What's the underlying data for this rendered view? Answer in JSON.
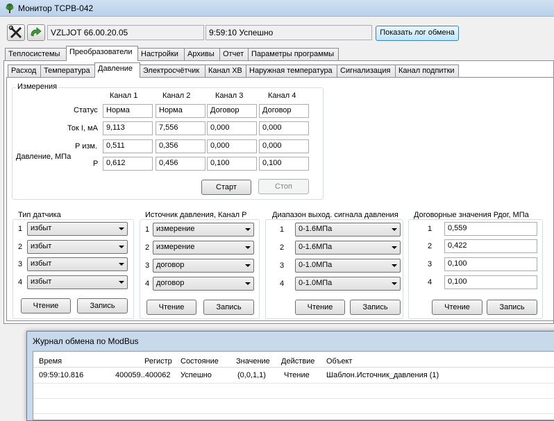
{
  "window": {
    "title": "Монитор ТСРВ-042",
    "app_icon": "tree-icon"
  },
  "toolbar": {
    "device": "VZLJOT 66.00.20.05",
    "status": "9:59:10 Успешно",
    "show_log_label": "Показать лог обмена",
    "tools_icon": "tools-icon",
    "refresh_icon": "refresh-arrow-icon"
  },
  "main_tabs": [
    "Теплосистемы",
    "Преобразователи",
    "Настройки",
    "Архивы",
    "Отчет",
    "Параметры программы"
  ],
  "sub_tabs": [
    "Расход",
    "Температура",
    "Давление",
    "Электросчётчик",
    "Канал ХВ",
    "Наружная температура",
    "Сигнализация",
    "Канал подпитки"
  ],
  "measure": {
    "title": "Измерения",
    "channels": [
      "Канал 1",
      "Канал 2",
      "Канал 3",
      "Канал 4"
    ],
    "status_label": "Статус",
    "current_label": "Ток I, мА",
    "pressure_label": "Давление, МПа",
    "p_meas_label": "P изм.",
    "p_label": "P",
    "status": [
      "Норма",
      "Норма",
      "Договор",
      "Договор"
    ],
    "current": [
      "9,113",
      "7,556",
      "0,000",
      "0,000"
    ],
    "p_meas": [
      "0,511",
      "0,356",
      "0,000",
      "0,000"
    ],
    "p": [
      "0,612",
      "0,456",
      "0,100",
      "0,100"
    ],
    "start_label": "Старт",
    "stop_label": "Стоп"
  },
  "sensor_type": {
    "title": "Тип датчика",
    "items": [
      "избыт",
      "избыт",
      "избыт",
      "избыт"
    ]
  },
  "pressure_source": {
    "title": "Источник давления, Канал P",
    "items": [
      "измерение",
      "измерение",
      "договор",
      "договор"
    ]
  },
  "output_range": {
    "title": "Диапазон выход. сигнала давления",
    "items": [
      "0-1.6МПа",
      "0-1.6МПа",
      "0-1.0МПа",
      "0-1.0МПа"
    ]
  },
  "contract": {
    "title": "Договорные значения Рдог, МПа",
    "items": [
      "0,559",
      "0,422",
      "0,100",
      "0,100"
    ]
  },
  "row_numbers": [
    "1",
    "2",
    "3",
    "4"
  ],
  "read_label": "Чтение",
  "write_label": "Запись",
  "log": {
    "title": "Журнал обмена по ModBus",
    "headers": [
      "Время",
      "Регистр",
      "Состояние",
      "Значение",
      "Действие",
      "Объект"
    ],
    "row": [
      "09:59:10.816",
      "400059..400062",
      "Успешно",
      "(0,0,1,1)",
      "Чтение",
      "Шаблон.Источник_давления (1)"
    ]
  }
}
